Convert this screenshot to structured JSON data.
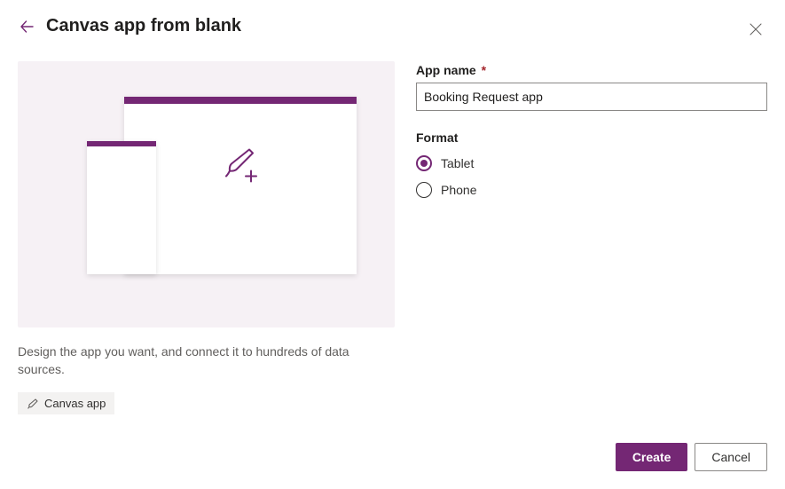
{
  "header": {
    "title": "Canvas app from blank"
  },
  "left": {
    "description": "Design the app you want, and connect it to hundreds of data sources.",
    "badge_label": "Canvas app"
  },
  "form": {
    "app_name_label": "App name",
    "app_name_required_mark": "*",
    "app_name_value": "Booking Request app",
    "format_label": "Format",
    "options": {
      "tablet": "Tablet",
      "phone": "Phone"
    }
  },
  "footer": {
    "create": "Create",
    "cancel": "Cancel"
  },
  "colors": {
    "accent": "#742774",
    "preview_bg": "#f6f1f5"
  }
}
